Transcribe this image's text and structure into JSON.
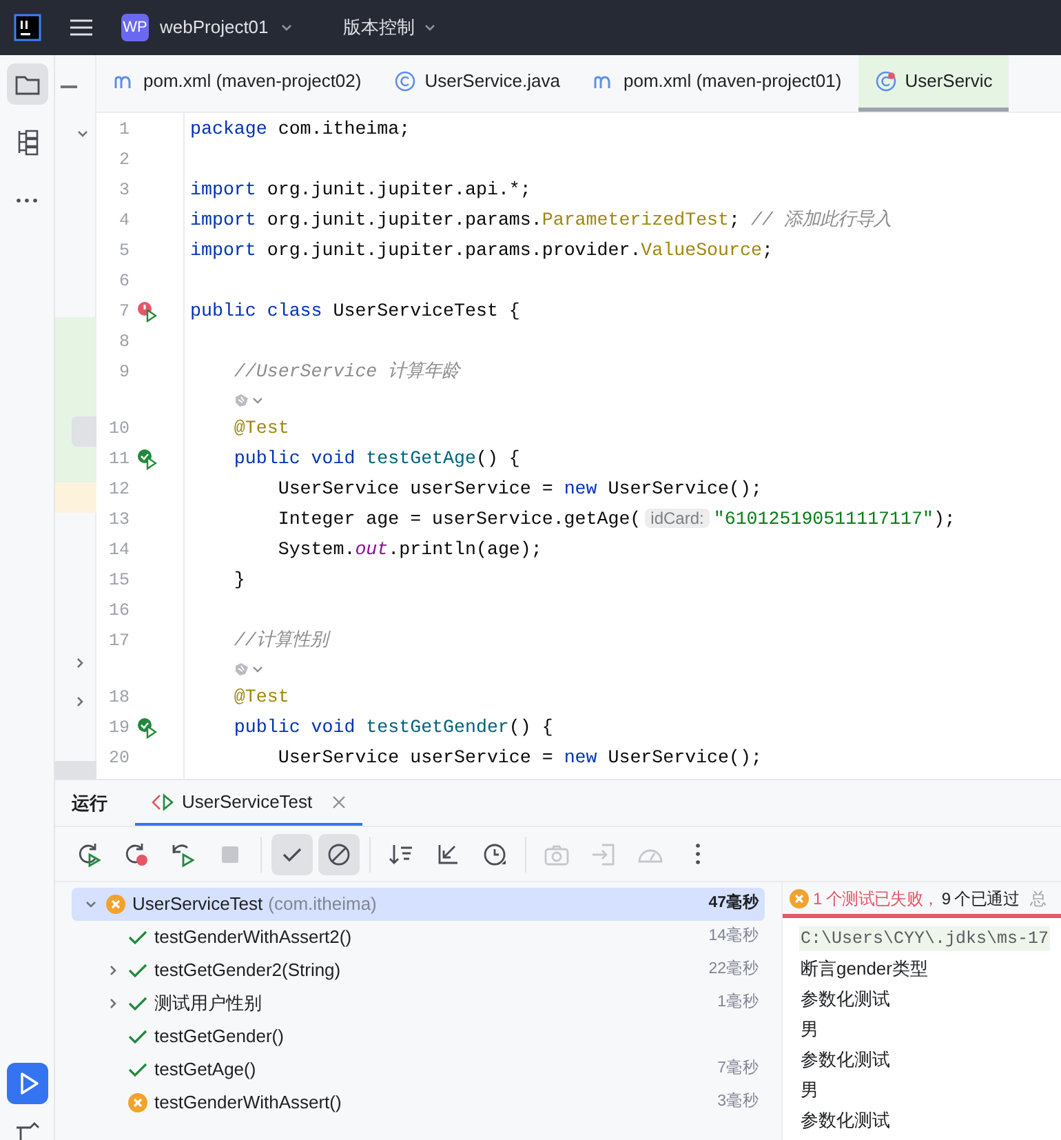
{
  "header": {
    "project_badge": "WP",
    "project": "webProject01",
    "vcs": "版本控制"
  },
  "rail": {
    "top": [
      {
        "kind": "project",
        "selected": true
      },
      {
        "kind": "structure",
        "selected": false
      },
      {
        "kind": "more",
        "selected": false
      }
    ],
    "bottom": [
      {
        "kind": "run",
        "selected": true
      },
      {
        "kind": "build",
        "selected": false
      }
    ]
  },
  "editor_tabs": [
    {
      "kind": "maven",
      "label": "pom.xml (maven-project02)",
      "selected": false
    },
    {
      "kind": "class",
      "label": "UserService.java",
      "selected": false
    },
    {
      "kind": "maven",
      "label": "pom.xml (maven-project01)",
      "selected": false
    },
    {
      "kind": "test",
      "label": "UserServic",
      "selected": true
    }
  ],
  "code_lines": [
    {
      "kind": "code",
      "number": "1",
      "tokens": [
        {
          "kind": "kw",
          "text": "package"
        },
        {
          "kind": "plain",
          "text": " com.itheima;"
        }
      ]
    },
    {
      "kind": "code",
      "number": "2"
    },
    {
      "kind": "code",
      "number": "3",
      "tokens": [
        {
          "kind": "kw",
          "text": "import"
        },
        {
          "kind": "plain",
          "text": " org.junit.jupiter.api.*;"
        }
      ]
    },
    {
      "kind": "code",
      "number": "4",
      "tokens": [
        {
          "kind": "kw",
          "text": "import"
        },
        {
          "kind": "plain",
          "text": " org.junit.jupiter.params."
        },
        {
          "kind": "type",
          "text": "ParameterizedTest"
        },
        {
          "kind": "plain",
          "text": "; "
        },
        {
          "kind": "comment",
          "text": "// 添加此行导入"
        }
      ]
    },
    {
      "kind": "code",
      "number": "5",
      "tokens": [
        {
          "kind": "kw",
          "text": "import"
        },
        {
          "kind": "plain",
          "text": " org.junit.jupiter.params.provider."
        },
        {
          "kind": "type",
          "text": "ValueSource"
        },
        {
          "kind": "plain",
          "text": ";"
        }
      ]
    },
    {
      "kind": "code",
      "number": "6"
    },
    {
      "kind": "test-failed",
      "number": "7",
      "tokens": [
        {
          "kind": "kw",
          "text": "public class"
        },
        {
          "kind": "plain",
          "text": " UserServiceTest {"
        }
      ]
    },
    {
      "kind": "code",
      "number": "8"
    },
    {
      "kind": "code",
      "number": "9",
      "tokens": [
        {
          "kind": "comment",
          "text": "    //UserService 计算年龄"
        }
      ]
    },
    {
      "kind": "inlay"
    },
    {
      "kind": "code",
      "number": "10",
      "tokens": [
        {
          "kind": "ann",
          "text": "    @Test"
        }
      ]
    },
    {
      "kind": "test-passed",
      "number": "11",
      "tokens": [
        {
          "kind": "kw",
          "text": "    public void "
        },
        {
          "kind": "method",
          "text": "testGetAge"
        },
        {
          "kind": "plain",
          "text": "() {"
        }
      ]
    },
    {
      "kind": "code",
      "number": "12",
      "tokens": [
        {
          "kind": "plain",
          "text": "        UserService userService = "
        },
        {
          "kind": "kw",
          "text": "new"
        },
        {
          "kind": "plain",
          "text": " UserService();"
        }
      ]
    },
    {
      "kind": "code",
      "number": "13",
      "tokens": [
        {
          "kind": "plain",
          "text": "        Integer age = userService.getAge("
        },
        {
          "kind": "hint",
          "text": "idCard:"
        },
        {
          "kind": "string",
          "text": "\"610125190511117117\""
        },
        {
          "kind": "plain",
          "text": ");"
        }
      ]
    },
    {
      "kind": "code",
      "number": "14",
      "tokens": [
        {
          "kind": "plain",
          "text": "        System."
        },
        {
          "kind": "static",
          "text": "out"
        },
        {
          "kind": "plain",
          "text": ".println(age);"
        }
      ]
    },
    {
      "kind": "code",
      "number": "15",
      "tokens": [
        {
          "kind": "plain",
          "text": "    }"
        }
      ]
    },
    {
      "kind": "code",
      "number": "16"
    },
    {
      "kind": "code",
      "number": "17",
      "tokens": [
        {
          "kind": "comment",
          "text": "    //计算性别"
        }
      ]
    },
    {
      "kind": "inlay"
    },
    {
      "kind": "code",
      "number": "18",
      "tokens": [
        {
          "kind": "ann",
          "text": "    @Test"
        }
      ]
    },
    {
      "kind": "test-passed",
      "number": "19",
      "tokens": [
        {
          "kind": "kw",
          "text": "    public void "
        },
        {
          "kind": "method",
          "text": "testGetGender"
        },
        {
          "kind": "plain",
          "text": "() {"
        }
      ]
    },
    {
      "kind": "code",
      "number": "20",
      "tokens": [
        {
          "kind": "plain",
          "text": "        UserService userService = "
        },
        {
          "kind": "kw",
          "text": "new"
        },
        {
          "kind": "plain",
          "text": " UserService();"
        }
      ]
    }
  ],
  "run_panel": {
    "title": "运行",
    "tab": {
      "label": "UserServiceTest",
      "selected": true
    },
    "toolbar": [
      [
        {
          "kind": "rerun",
          "on": false,
          "disabled": false
        },
        {
          "kind": "rerun-failed",
          "on": false,
          "disabled": false
        },
        {
          "kind": "toggle-rerun",
          "on": false,
          "disabled": false
        },
        {
          "kind": "stop",
          "on": false,
          "disabled": true
        }
      ],
      [
        {
          "kind": "show-passed",
          "on": true,
          "disabled": false
        },
        {
          "kind": "show-ignored",
          "on": true,
          "disabled": false
        }
      ],
      [
        {
          "kind": "sort",
          "on": false,
          "disabled": false
        },
        {
          "kind": "collapse",
          "on": false,
          "disabled": false
        },
        {
          "kind": "history",
          "on": false,
          "disabled": false
        }
      ],
      [
        {
          "kind": "snapshot",
          "on": false,
          "disabled": true
        },
        {
          "kind": "import",
          "on": false,
          "disabled": true
        },
        {
          "kind": "gauge",
          "on": false,
          "disabled": true
        },
        {
          "kind": "more",
          "on": false,
          "disabled": false
        }
      ]
    ],
    "tree": {
      "label": "UserServiceTest",
      "detail": "(com.itheima)",
      "failed": true,
      "time": "47毫秒",
      "selected": true,
      "expanded": true,
      "children": [
        {
          "label": "testGenderWithAssert2()",
          "failed": false,
          "time": "14毫秒",
          "selected": false
        },
        {
          "label": "testGetGender2(String)",
          "failed": false,
          "time": "22毫秒",
          "selected": false,
          "expanded": false
        },
        {
          "label": "测试用户性别",
          "failed": false,
          "time": "1毫秒",
          "selected": false,
          "expanded": false
        },
        {
          "label": "testGetGender()",
          "failed": false,
          "selected": false
        },
        {
          "label": "testGetAge()",
          "failed": false,
          "time": "7毫秒",
          "selected": false
        },
        {
          "label": "testGenderWithAssert()",
          "failed": true,
          "time": "3毫秒",
          "selected": false
        }
      ]
    },
    "summary": {
      "failed": "1 个测试已失败，",
      "passed": "9 个已通过",
      "total": "总"
    },
    "console": [
      {
        "kind": "command",
        "text": "C:\\Users\\CYY\\.jdks\\ms-17"
      },
      {
        "kind": "output",
        "text": "断言gender类型"
      },
      {
        "kind": "output",
        "text": "参数化测试"
      },
      {
        "kind": "output",
        "text": "男"
      },
      {
        "kind": "output",
        "text": "参数化测试"
      },
      {
        "kind": "output",
        "text": "男"
      },
      {
        "kind": "output",
        "text": "参数化测试"
      }
    ]
  }
}
